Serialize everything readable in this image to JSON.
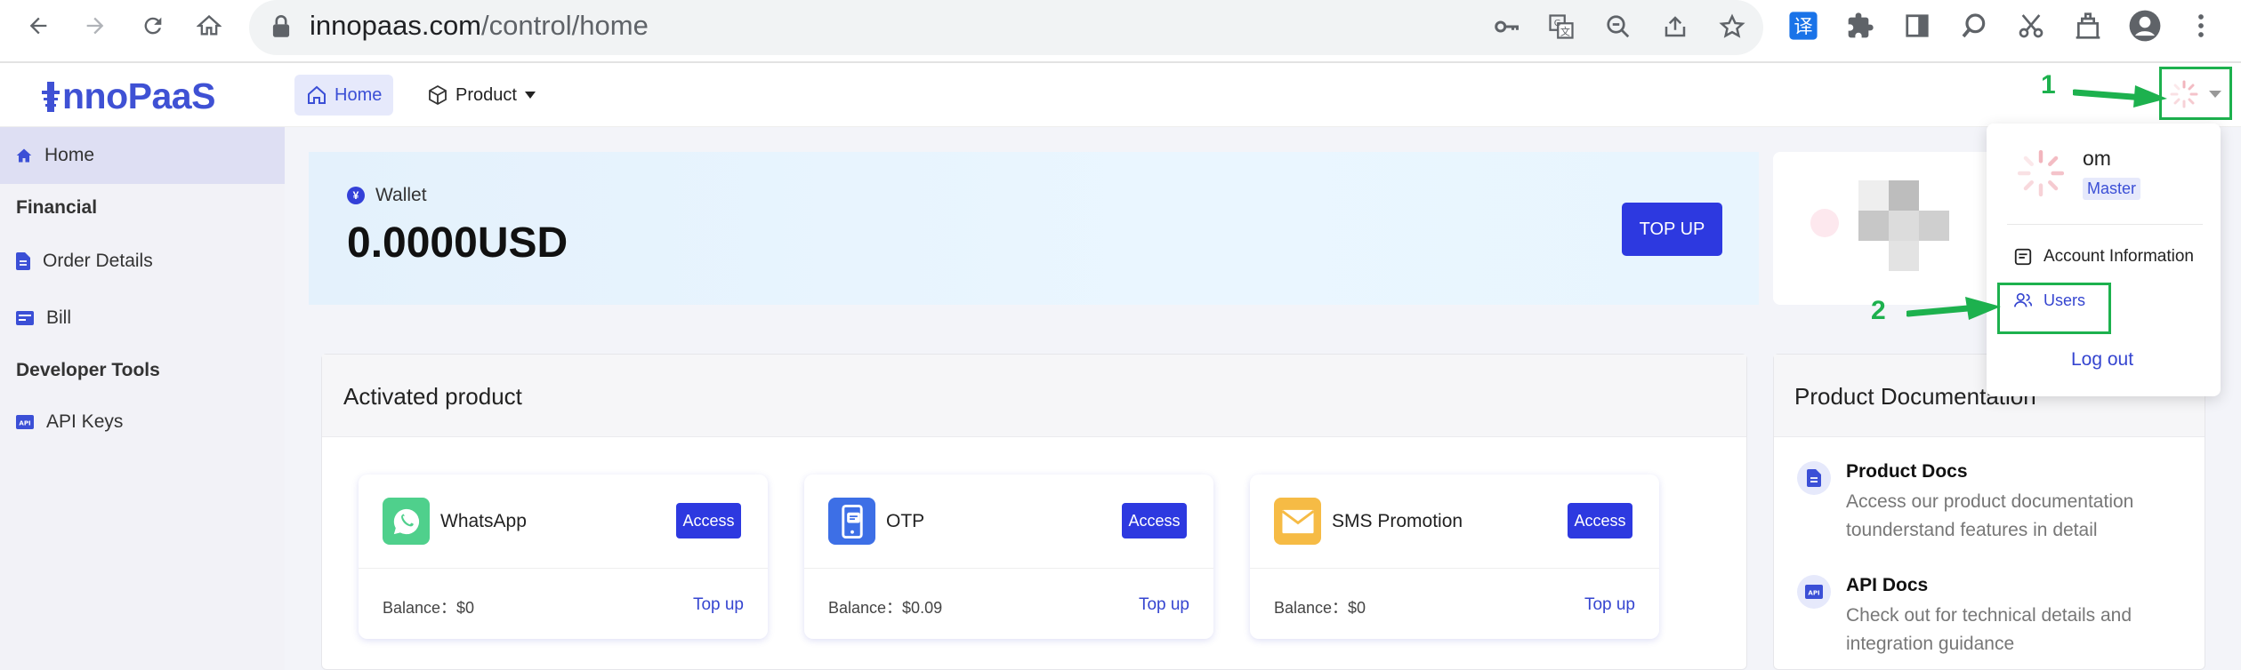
{
  "browser": {
    "url_domain": "innopaas.com",
    "url_path": "/control/home"
  },
  "header": {
    "logo": "nnoPaaS",
    "nav": [
      {
        "label": "Home"
      },
      {
        "label": "Product"
      }
    ]
  },
  "sidebar": {
    "items": [
      {
        "label": "Home"
      },
      {
        "label": "Financial"
      },
      {
        "label": "Order Details"
      },
      {
        "label": "Bill"
      },
      {
        "label": "Developer Tools"
      },
      {
        "label": "API Keys"
      }
    ]
  },
  "wallet": {
    "label": "Wallet",
    "amount": "0.0000USD",
    "top_up_label": "TOP UP",
    "currency_glyph": "¥"
  },
  "activated": {
    "title": "Activated product",
    "cards": [
      {
        "name": "WhatsApp",
        "access": "Access",
        "balance": "Balance：$0",
        "top_up": "Top up",
        "color": "#4fd08c"
      },
      {
        "name": "OTP",
        "access": "Access",
        "balance": "Balance：$0.09",
        "top_up": "Top up",
        "color": "#3d6fe6"
      },
      {
        "name": "SMS Promotion",
        "access": "Access",
        "balance": "Balance：$0",
        "top_up": "Top up",
        "color": "#f6bb45"
      }
    ]
  },
  "docs": {
    "title": "Product Documentation",
    "items": [
      {
        "title": "Product Docs",
        "desc": "Access our product documentation tounderstand features in detail"
      },
      {
        "title": "API Docs",
        "desc": "Check out for technical details and integration guidance"
      }
    ]
  },
  "user_menu": {
    "name": "om",
    "role": "Master",
    "account_info": "Account Information",
    "users": "Users",
    "logout": "Log out"
  },
  "annotations": {
    "step1": "1",
    "step2": "2",
    "arrow_color": "#1db14e"
  },
  "colors": {
    "brand": "#3f51d4",
    "button": "#2d39e0"
  }
}
